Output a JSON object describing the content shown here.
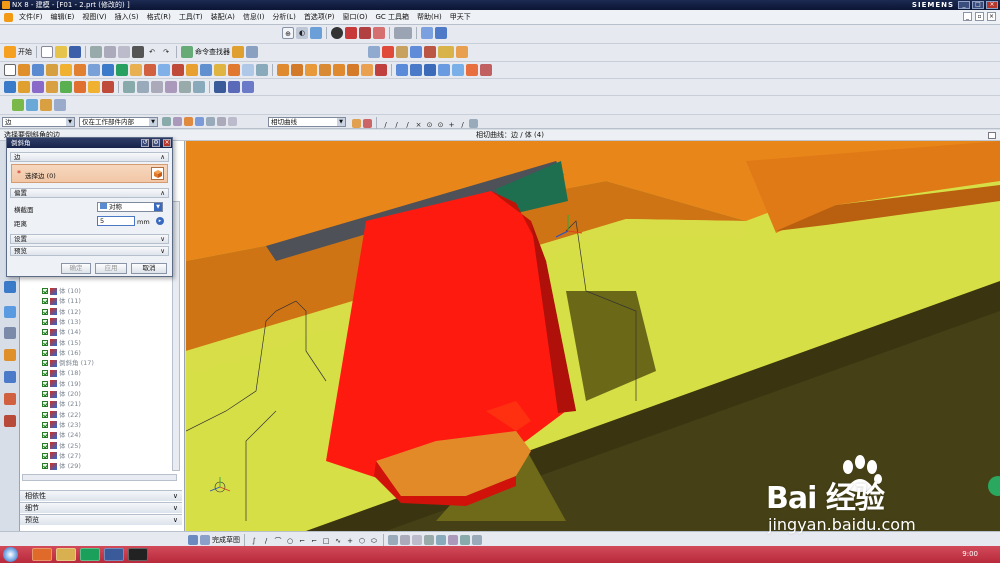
{
  "titlebar": {
    "title": "NX 8 - 建模 - [F01 - 2.prt (修改的) ]",
    "brand": "SIEMENS"
  },
  "menu": [
    "文件(F)",
    "编辑(E)",
    "视图(V)",
    "插入(S)",
    "格式(R)",
    "工具(T)",
    "装配(A)",
    "信息(I)",
    "分析(L)",
    "首选项(P)",
    "窗口(O)",
    "GC 工具箱",
    "帮助(H)",
    "甲天下"
  ],
  "toolbar": {
    "start_label": "开始",
    "command_finder_label": "命令查找器"
  },
  "selection_bar": {
    "filter_value": "边",
    "scope_value": "仅在工作部件内部",
    "rule_value": "相切曲线"
  },
  "status": {
    "prompt": "选择要倒斜角的边",
    "message": "相切曲线：边 / 体 (4)"
  },
  "dialog": {
    "title": "倒斜角",
    "section_edge": "边",
    "select_edge": "选择边 (0)",
    "section_offset": "偏置",
    "cross_section_label": "横截面",
    "cross_section_value": "对称",
    "distance_label": "距离",
    "distance_value": "5",
    "distance_unit": "mm",
    "section_settings": "设置",
    "section_preview": "预览",
    "btn_ok": "确定",
    "btn_apply": "应用",
    "btn_cancel": "取消"
  },
  "navigator": {
    "items": [
      {
        "label": "体 (10)"
      },
      {
        "label": "体 (11)"
      },
      {
        "label": "体 (12)"
      },
      {
        "label": "体 (13)"
      },
      {
        "label": "体 (14)"
      },
      {
        "label": "体 (15)"
      },
      {
        "label": "体 (16)"
      },
      {
        "label": "倒斜角 (17)"
      },
      {
        "label": "体 (18)"
      },
      {
        "label": "体 (19)"
      },
      {
        "label": "体 (20)"
      },
      {
        "label": "体 (21)"
      },
      {
        "label": "体 (22)"
      },
      {
        "label": "体 (23)"
      },
      {
        "label": "体 (24)"
      },
      {
        "label": "体 (25)"
      },
      {
        "label": "体 (27)"
      },
      {
        "label": "体 (29)"
      }
    ],
    "sections": [
      "相依性",
      "细节",
      "预览"
    ]
  },
  "bottombar": {
    "sketch_label": "完成草图"
  },
  "taskbar": {
    "clock": "9:00"
  },
  "watermark": {
    "logo": "Bai 经验",
    "url": "jingyan.baidu.com"
  },
  "colors": {
    "highlight_red": "#ff1a10",
    "model_yellow": "#d8de48",
    "model_orange": "#e98518",
    "taskbar": "#c23848"
  }
}
